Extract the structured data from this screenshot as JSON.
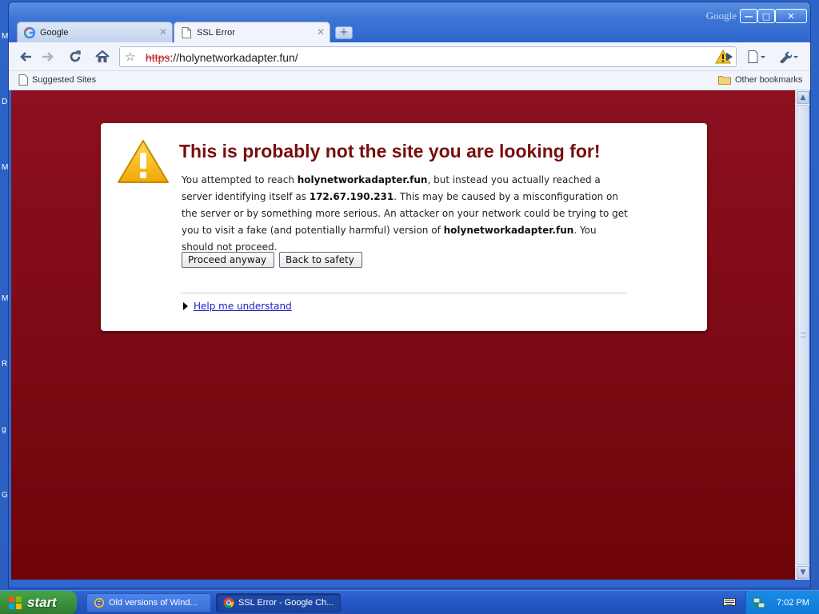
{
  "desktop": {
    "edge_letters": [
      "M",
      "D",
      "M",
      "M",
      "R",
      "g",
      "G"
    ]
  },
  "window": {
    "brand": "Google",
    "controls": {
      "minimize": "—",
      "maximize": "□",
      "close": "✕"
    },
    "tabs": [
      {
        "label": "Google",
        "icon": "google-icon"
      },
      {
        "label": "SSL Error",
        "icon": "page-icon"
      }
    ],
    "new_tab": "+"
  },
  "toolbar": {
    "url_scheme": "https",
    "url_rest": "://holynetworkadapter.fun/",
    "icons": [
      "back-icon",
      "forward-icon",
      "reload-icon",
      "home-icon",
      "star-icon",
      "warning-icon",
      "play-icon",
      "page-menu-icon",
      "wrench-icon"
    ]
  },
  "bookmarks": {
    "left": "Suggested Sites",
    "right": "Other bookmarks"
  },
  "error": {
    "title": "This is probably not the site you are looking for!",
    "p1": "You attempted to reach ",
    "host": "holynetworkadapter.fun",
    "p2": ", but instead you actually reached a server identifying itself as ",
    "ip": "172.67.190.231",
    "p3": ". This may be caused by a misconfiguration on the server or by something more serious. An attacker on your network could be trying to get you to visit a fake (and potentially harmful) version of ",
    "p4": ". You should not proceed.",
    "proceed": "Proceed anyway",
    "back": "Back to safety",
    "help": "Help me understand"
  },
  "taskbar": {
    "start": "start",
    "tasks": [
      {
        "label": "Old versions of Wind..."
      },
      {
        "label": "SSL Error - Google Ch..."
      }
    ],
    "clock": "7:02 PM"
  },
  "colors": {
    "error_background": "#7c0a14",
    "error_title": "#7a0d0d",
    "link": "#1a23c4",
    "taskbar": "#2457c5"
  }
}
